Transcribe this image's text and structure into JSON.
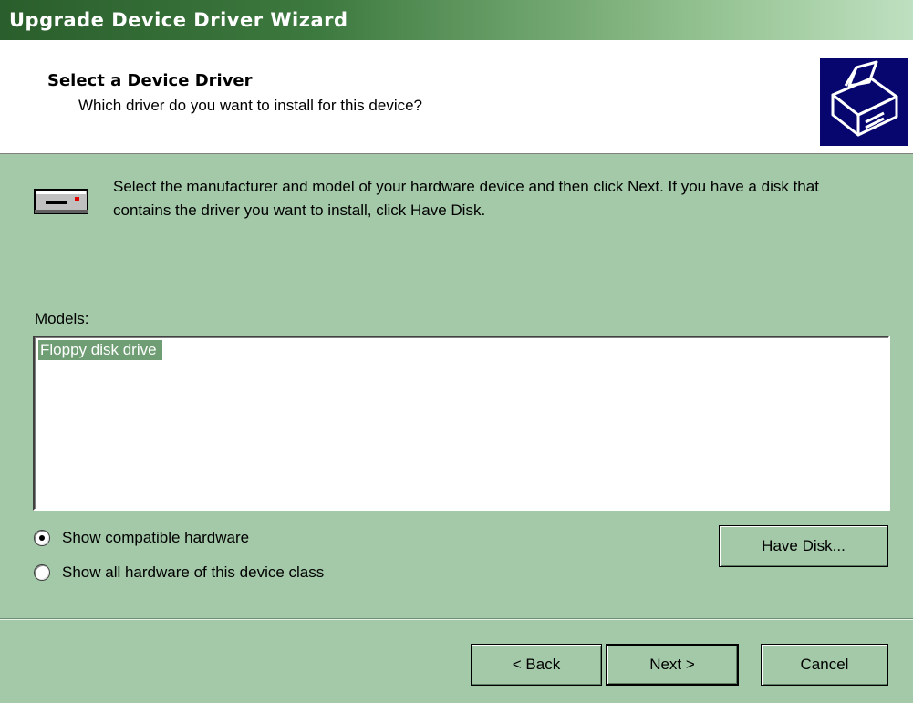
{
  "window": {
    "title": "Upgrade Device Driver Wizard"
  },
  "header": {
    "title": "Select a Device Driver",
    "subtitle": "Which driver do you want to install for this device?",
    "icon": "hardware-wizard-icon"
  },
  "intro": {
    "icon": "floppy-drive-icon",
    "text": "Select the manufacturer and model of your hardware device and then click Next. If you have a disk that contains the driver you want to install, click Have Disk."
  },
  "models": {
    "label": "Models:",
    "items": [
      {
        "label": "Floppy disk drive",
        "selected": true
      }
    ]
  },
  "options": {
    "show_compatible": {
      "label": "Show compatible hardware",
      "checked": true
    },
    "show_all": {
      "label": "Show all hardware of this device class",
      "checked": false
    }
  },
  "buttons": {
    "have_disk": "Have Disk...",
    "back": "< Back",
    "next": "Next >",
    "cancel": "Cancel"
  },
  "colors": {
    "dialog_bg": "#a3c9a8",
    "title_bar_start": "#2a5e2c",
    "title_bar_end": "#bfe0c0",
    "selection": "#6f9e74",
    "wizard_icon_bg": "#06066e"
  }
}
